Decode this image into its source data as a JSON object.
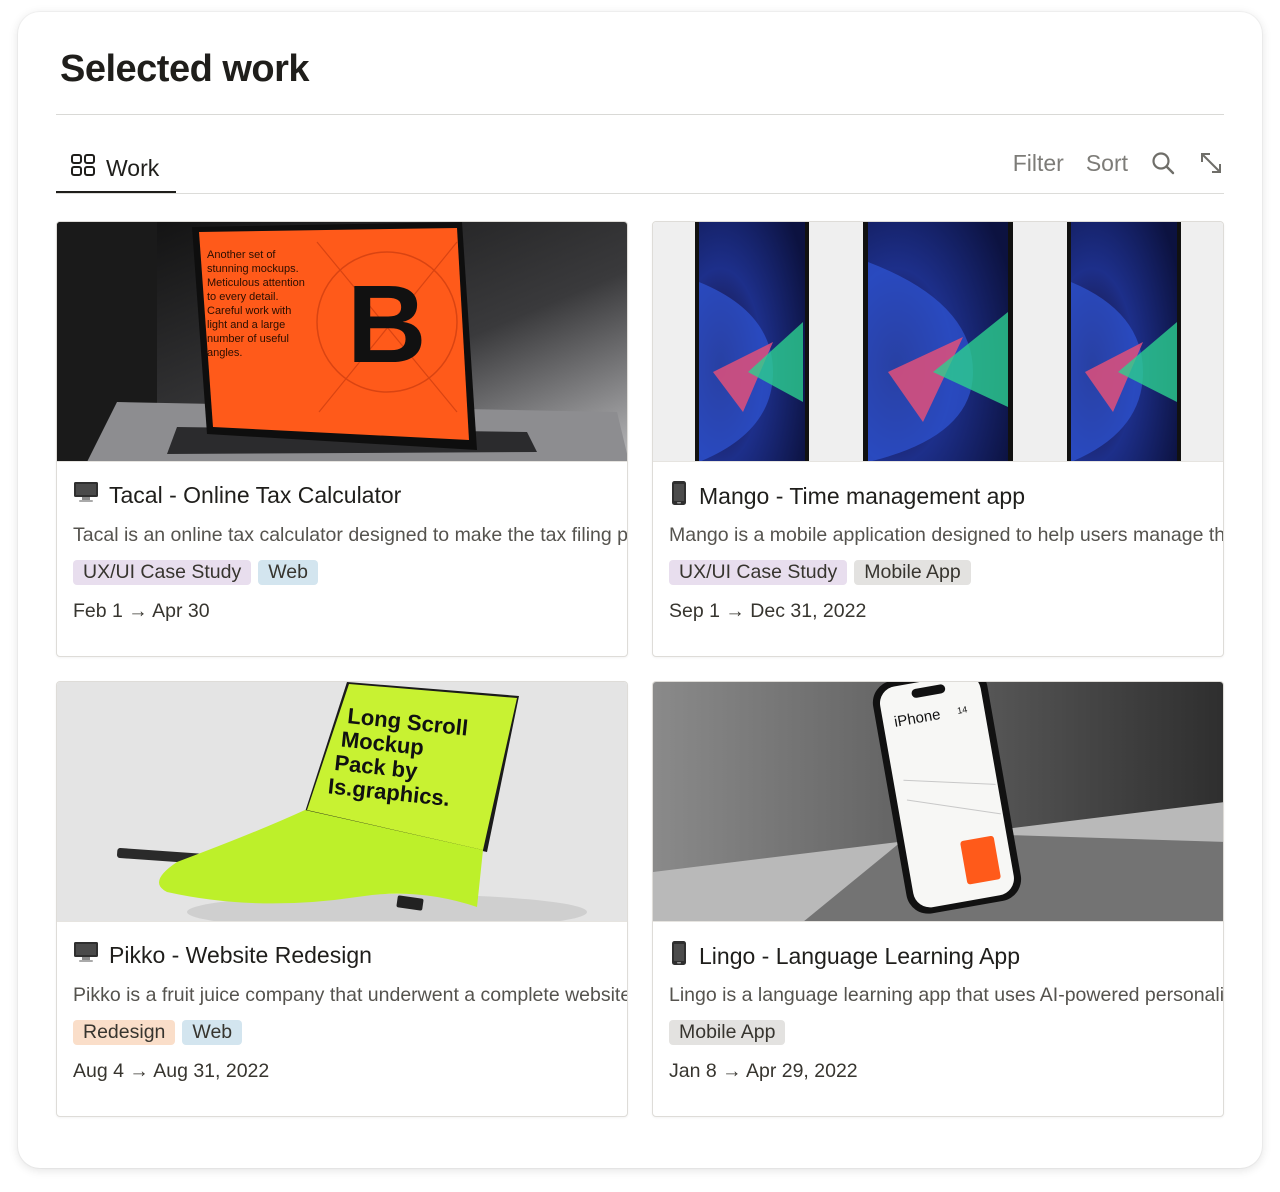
{
  "page": {
    "title": "Selected work"
  },
  "view": {
    "tab_label": "Work",
    "filter_label": "Filter",
    "sort_label": "Sort",
    "icons": {
      "tab": "gallery-grid-icon",
      "search": "search-icon",
      "expand": "expand-icon"
    }
  },
  "colors": {
    "tag_purple": "#e8deee",
    "tag_blue": "#d3e5ef",
    "tag_gray": "#e3e2e0",
    "tag_orange": "#fadec9"
  },
  "cards": [
    {
      "icon": "desktop-computer-icon",
      "title": "Tacal - Online Tax Calculator",
      "description": "Tacal is an online tax calculator designed to make the tax filing process easier",
      "tags": [
        {
          "label": "UX/UI Case Study",
          "color": "#e8deee"
        },
        {
          "label": "Web",
          "color": "#d3e5ef"
        }
      ],
      "date": "Feb 1 → Apr 30",
      "cover_text": "Another set of stunning mockups. Meticulous attention to every detail. Careful work with light and a large number of useful angles.",
      "cover_letter": "B"
    },
    {
      "icon": "mobile-phone-icon",
      "title": "Mango - Time management app",
      "description": "Mango is a mobile application designed to help users manage their time",
      "tags": [
        {
          "label": "UX/UI Case Study",
          "color": "#e8deee"
        },
        {
          "label": "Mobile App",
          "color": "#e3e2e0"
        }
      ],
      "date": "Sep 1 → Dec 31, 2022"
    },
    {
      "icon": "desktop-computer-icon",
      "title": "Pikko - Website Redesign",
      "description": "Pikko is a fruit juice company that underwent a complete website redesign",
      "tags": [
        {
          "label": "Redesign",
          "color": "#fadec9"
        },
        {
          "label": "Web",
          "color": "#d3e5ef"
        }
      ],
      "date": "Aug 4 → Aug 31, 2022",
      "cover_text": "Long Scroll Mockup Pack by Is.graphics."
    },
    {
      "icon": "mobile-phone-icon",
      "title": "Lingo - Language Learning App",
      "description": "Lingo is a language learning app that uses AI-powered personalization",
      "tags": [
        {
          "label": "Mobile App",
          "color": "#e3e2e0"
        }
      ],
      "date": "Jan 8 → Apr 29, 2022",
      "cover_text": "iPhone 14"
    }
  ]
}
